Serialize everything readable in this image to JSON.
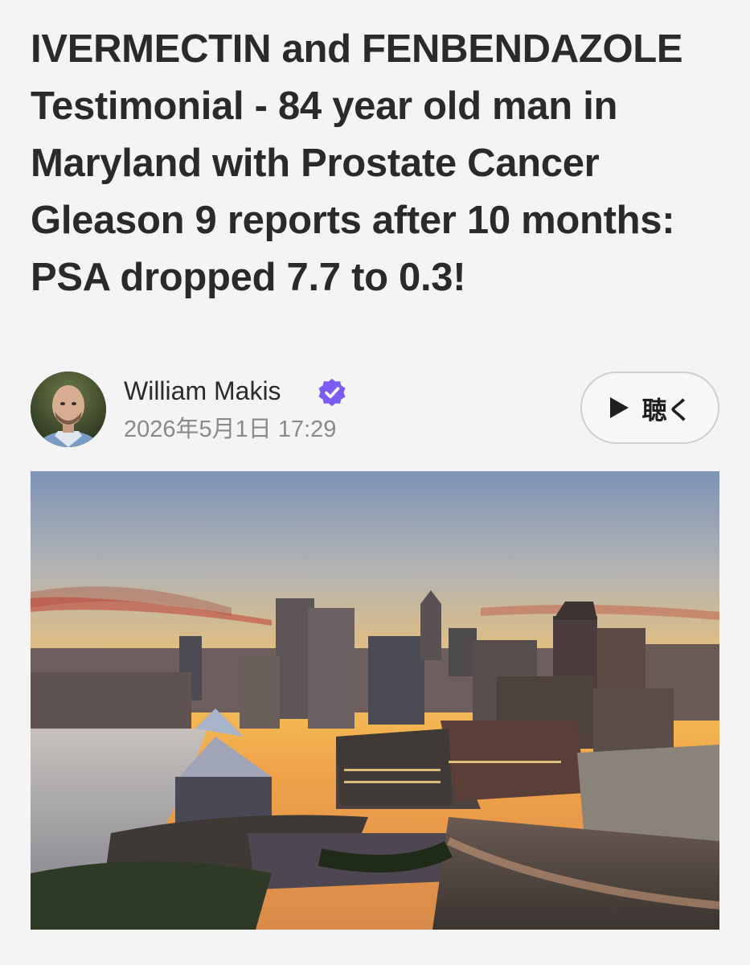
{
  "article": {
    "title": "IVERMECTIN and FENBENDAZOLE Testimonial - 84 year old man in Maryland with Prostate Cancer Gleason 9 reports after 10 months: PSA dropped 7.7 to 0.3!",
    "author": {
      "name": "William Makis",
      "verified": true,
      "avatar_icon": "author-avatar-photo"
    },
    "date": "2026年5月1日 17:29"
  },
  "listen_button": {
    "label": "聴く",
    "icon": "play-icon"
  },
  "hero_image": {
    "subject": "city-skyline-at-sunset-photo"
  },
  "colors": {
    "verified_badge": "#7b5cf5",
    "title_text": "#2a2a2a",
    "date_text": "#8a8a8a",
    "background": "#f4f4f4"
  }
}
